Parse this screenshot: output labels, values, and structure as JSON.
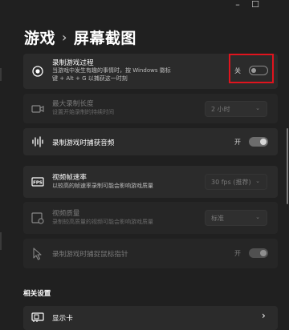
{
  "window": {
    "minimize": "–",
    "maximize": "☐"
  },
  "breadcrumb": {
    "parent": "游戏",
    "separator": "›",
    "current": "屏幕截图"
  },
  "settings": [
    {
      "id": "record-gameplay",
      "label": "录制游戏过程",
      "desc_line1": "当游戏中发生有趣的事情时，按 Windows 徽标",
      "desc_line2": "键 + Alt + G 以捕获这一时刻",
      "toggle_label": "关",
      "toggle_state": "off",
      "icon": "record-icon"
    },
    {
      "id": "max-length",
      "label": "最大录制长度",
      "desc_line1": "设置开始录制的持续时间",
      "dropdown_value": "2 小时",
      "icon": "video-camera-icon",
      "disabled": true
    },
    {
      "id": "capture-audio",
      "label": "录制游戏时捕获音频",
      "toggle_label": "开",
      "toggle_state": "on",
      "icon": "audio-waveform-icon"
    },
    {
      "id": "frame-rate",
      "label": "视频帧速率",
      "desc_line1": "以较高的帧速率录制可能会影响游戏质量",
      "dropdown_value": "30 fps (推荐)",
      "icon": "fps-icon"
    },
    {
      "id": "video-quality",
      "label": "视频质量",
      "desc_line1": "录制较高质量的视频可能会影响游戏质量",
      "dropdown_value": "标准",
      "icon": "video-quality-icon",
      "disabled": true
    },
    {
      "id": "capture-cursor",
      "label": "录制游戏时捕捉鼠标指针",
      "toggle_label": "开",
      "toggle_state": "on",
      "icon": "mouse-pointer-icon",
      "disabled": true
    }
  ],
  "related": {
    "heading": "相关设置",
    "items": [
      {
        "label": "显示卡",
        "chevron": "›",
        "icon": "graphics-card-icon"
      }
    ]
  },
  "chevron_down": "⌄",
  "colors": {
    "background": "#202020",
    "card": "#2b2b2b",
    "highlight": "#e0141e"
  }
}
